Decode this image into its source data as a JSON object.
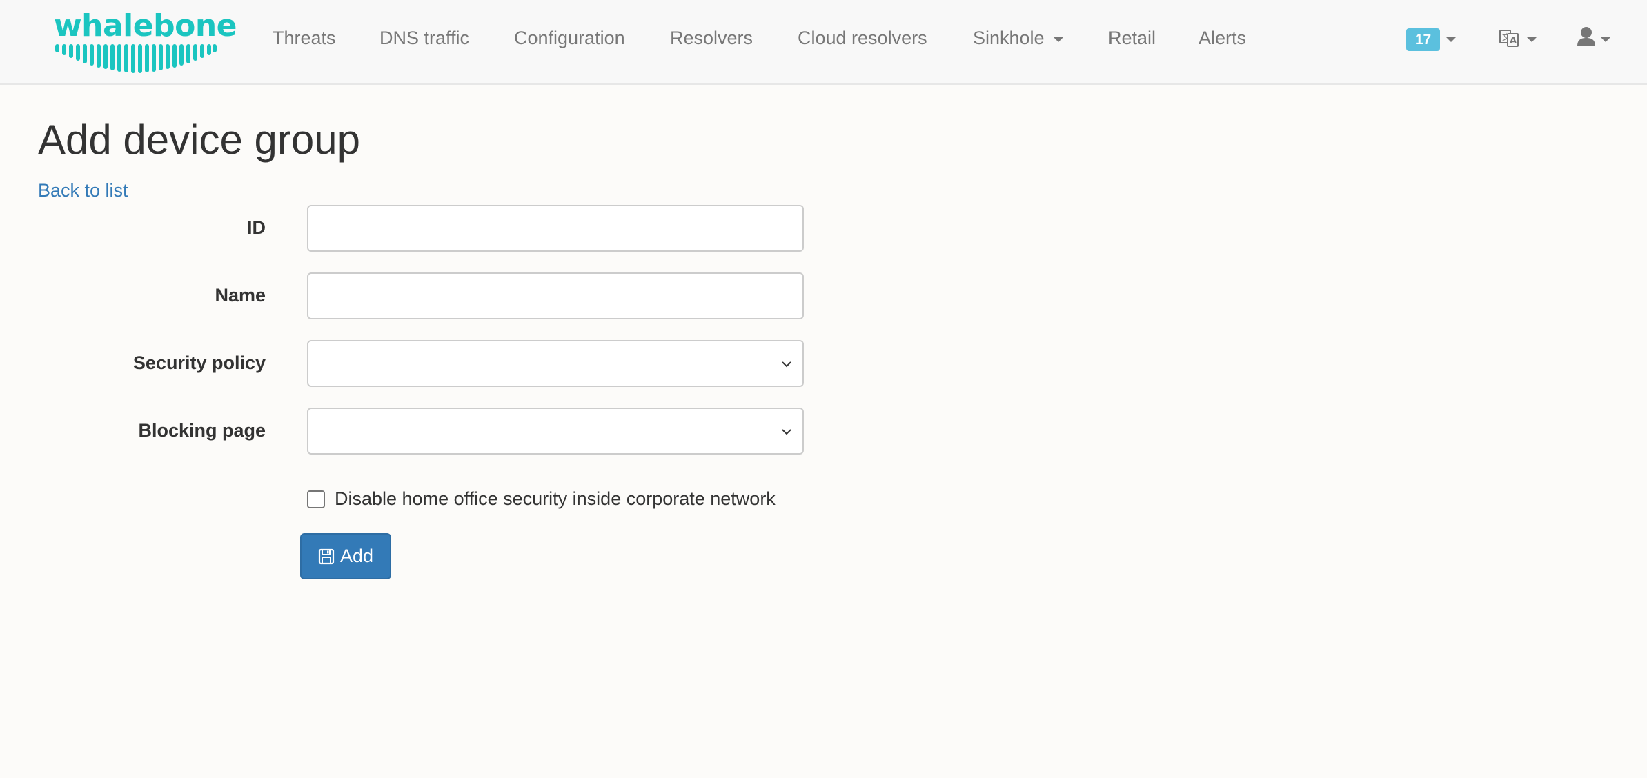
{
  "brand": {
    "logo_text": "whalebone",
    "accent_color": "#1bc5c0"
  },
  "navbar": {
    "items": [
      {
        "label": "Threats",
        "has_dropdown": false
      },
      {
        "label": "DNS traffic",
        "has_dropdown": false
      },
      {
        "label": "Configuration",
        "has_dropdown": false
      },
      {
        "label": "Resolvers",
        "has_dropdown": false
      },
      {
        "label": "Cloud resolvers",
        "has_dropdown": false
      },
      {
        "label": "Sinkhole",
        "has_dropdown": true
      },
      {
        "label": "Retail",
        "has_dropdown": false
      },
      {
        "label": "Alerts",
        "has_dropdown": false
      }
    ],
    "notifications_count": "17",
    "notifications_color": "#5bc0de",
    "icons": [
      "chevron-down-icon",
      "language-icon",
      "user-icon"
    ]
  },
  "page": {
    "title": "Add device group",
    "back_link": "Back to list"
  },
  "form": {
    "id": {
      "label": "ID",
      "value": ""
    },
    "name": {
      "label": "Name",
      "value": ""
    },
    "security_policy": {
      "label": "Security policy",
      "selected": ""
    },
    "blocking_page": {
      "label": "Blocking page",
      "selected": ""
    },
    "home_office_checkbox": {
      "label": "Disable home office security inside corporate network",
      "checked": false
    },
    "submit": {
      "label": "Add",
      "icon": "save-icon",
      "color": "#337ab7"
    }
  }
}
